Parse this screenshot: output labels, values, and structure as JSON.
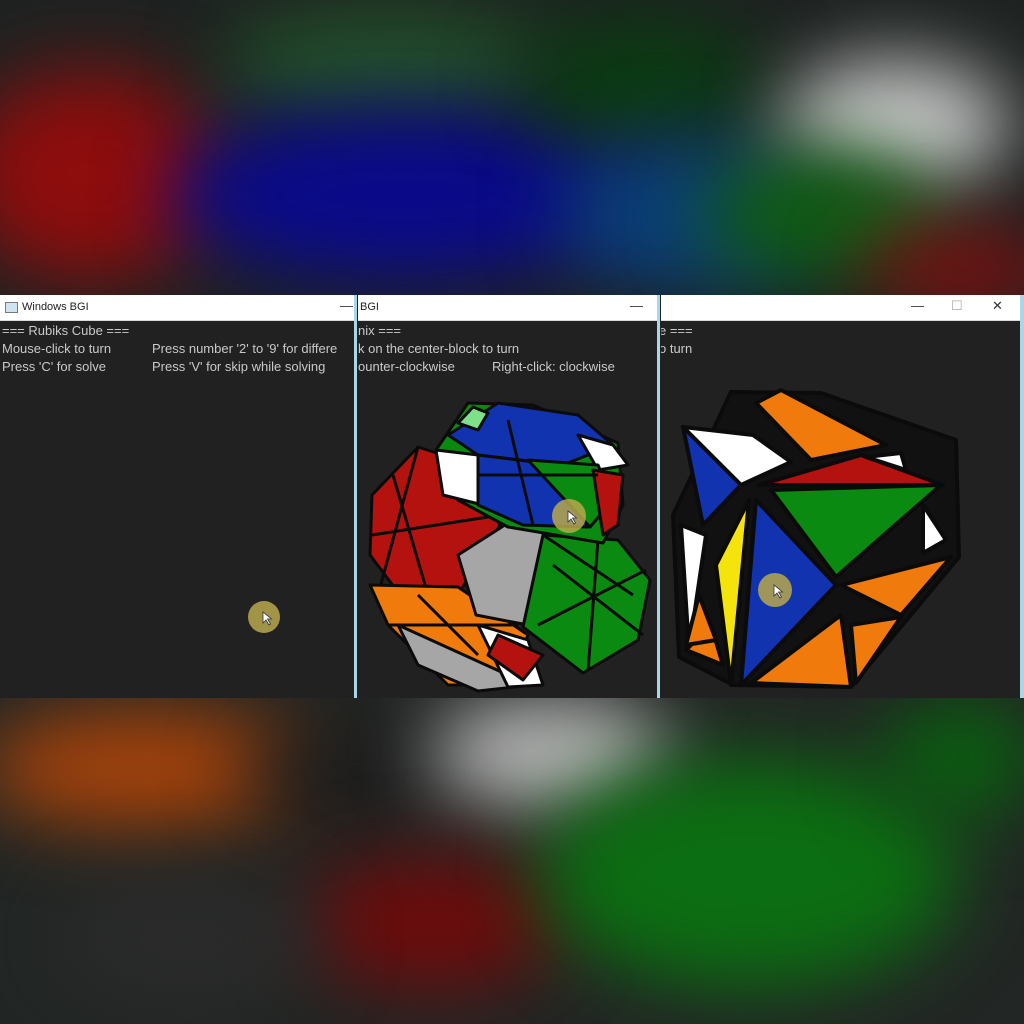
{
  "windows": [
    {
      "title": "Windows BGI",
      "lines": [
        {
          "col1": "=== Rubiks Cube ==="
        },
        {
          "col1": "Mouse-click to turn",
          "col2": "Press number '2' to '9' for differe"
        },
        {
          "col1": "Press 'C' for solve",
          "col2": "Press 'V' for skip while solving"
        }
      ],
      "controls": {
        "minimize": "—"
      }
    },
    {
      "title": "BGI",
      "lines": [
        {
          "col1": "nix ==="
        },
        {
          "col1": "k on the center-block to turn"
        },
        {
          "col1": "ounter-clockwise",
          "col2": "Right-click: clockwise"
        }
      ],
      "controls": {
        "minimize": "—"
      }
    },
    {
      "title": "",
      "lines": [
        {
          "col1": "e ==="
        },
        {
          "col1": "o turn"
        }
      ],
      "controls": {
        "minimize": "—",
        "maximize": "☐",
        "close": "✕"
      }
    }
  ],
  "colors": {
    "red": "#b3120f",
    "green": "#0a8a10",
    "blue": "#1233b0",
    "yellow": "#f4e40c",
    "orange": "#f07a0c",
    "white": "#ffffff",
    "gray": "#a6a6a6",
    "black": "#111111",
    "accent": "#a9d7ea",
    "cursor": "#b7a84c"
  },
  "icons": [
    "window-icon",
    "minimize-icon",
    "maximize-icon",
    "close-icon",
    "mouse-cursor-icon"
  ]
}
